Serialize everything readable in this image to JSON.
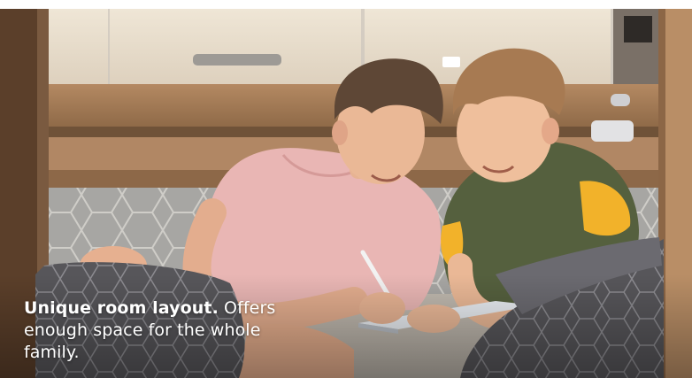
{
  "caption": {
    "headline": "Unique room layout.",
    "body": " Offers enough space for the whole family."
  },
  "colors": {
    "cabinet": "#e7dccb",
    "wood_shelf": "#a67b55",
    "pink_shirt": "#e9b6b4",
    "green_vest": "#55603e",
    "yellow_sleeve": "#f2b22a",
    "cushion": "#57565a",
    "caption_text": "#ffffff"
  }
}
